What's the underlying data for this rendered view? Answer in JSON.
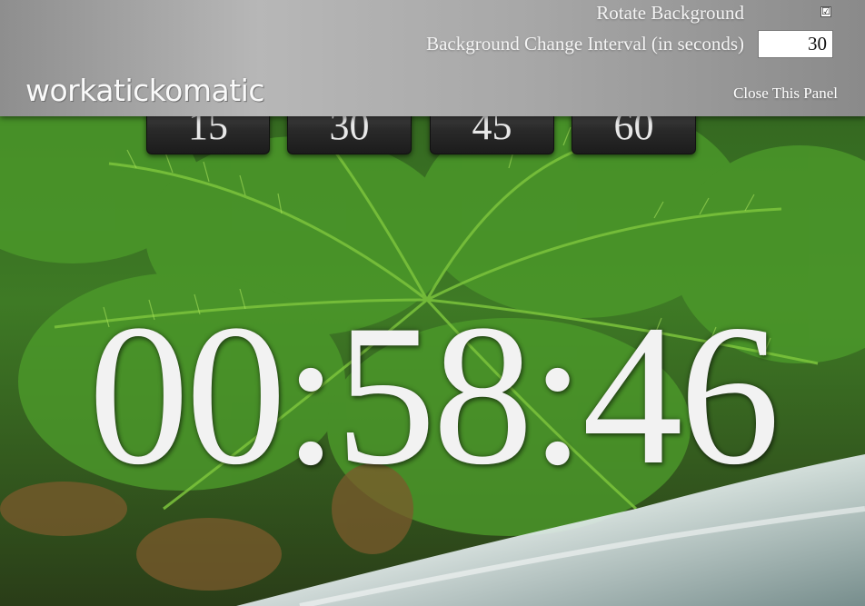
{
  "panel": {
    "rotate_label": "Rotate Background",
    "rotate_checked": "☑",
    "interval_label": "Background Change Interval (in seconds)",
    "interval_value": "30",
    "logo": "workatickomatic",
    "close_label": "Close This Panel"
  },
  "presets": [
    "15",
    "30",
    "45",
    "60"
  ],
  "timer": {
    "display": "00:58:46"
  },
  "background": {
    "description_colors": [
      "#2d5a1b",
      "#4f9a2b",
      "#8fd14a",
      "#dfe7ea"
    ]
  }
}
